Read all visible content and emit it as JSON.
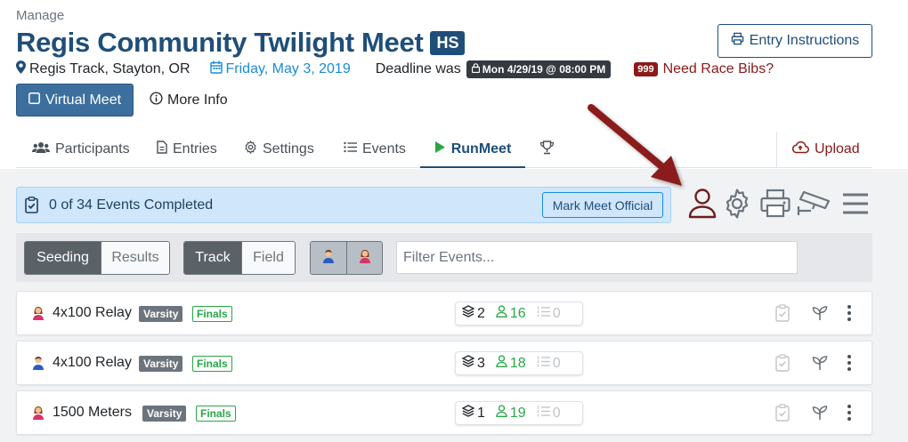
{
  "header": {
    "manage_label": "Manage",
    "title": "Regis Community Twilight Meet",
    "level_badge": "HS",
    "entry_button": "Entry Instructions",
    "location": "Regis Track, Stayton, OR",
    "date": "Friday, May 3, 2019",
    "deadline_label": "Deadline was",
    "deadline_value": "Mon 4/29/19 @ 08:00 PM",
    "bib_badge": "999",
    "bib_link": "Need Race Bibs?",
    "virtual_button": "Virtual Meet",
    "more_info": "More Info"
  },
  "tabs": [
    {
      "label": "Participants",
      "icon": "users-icon"
    },
    {
      "label": "Entries",
      "icon": "document-icon"
    },
    {
      "label": "Settings",
      "icon": "gear-icon"
    },
    {
      "label": "Events",
      "icon": "list-icon"
    },
    {
      "label": "RunMeet",
      "icon": "play-icon",
      "active": true
    },
    {
      "label": "",
      "icon": "trophy-icon"
    }
  ],
  "upload_tab": "Upload",
  "status": {
    "completed_text": "0 of 34 Events Completed",
    "mark_official": "Mark Meet Official"
  },
  "filters": {
    "seeding": "Seeding",
    "results": "Results",
    "track": "Track",
    "field": "Field",
    "search_placeholder": "Filter Events..."
  },
  "events": [
    {
      "gender": "female",
      "name": "4x100 Relay",
      "level": "Varsity",
      "round": "Finals",
      "heats": "2",
      "entries": "16",
      "results": "0"
    },
    {
      "gender": "male",
      "name": "4x100 Relay",
      "level": "Varsity",
      "round": "Finals",
      "heats": "3",
      "entries": "18",
      "results": "0"
    },
    {
      "gender": "female",
      "name": "1500 Meters",
      "level": "Varsity",
      "round": "Finals",
      "heats": "1",
      "entries": "19",
      "results": "0"
    }
  ],
  "colors": {
    "primary": "#1f4e79",
    "link": "#1a8cd8",
    "danger": "#8b1a1a",
    "success": "#28a745",
    "arrow": "#8b1a1a"
  }
}
